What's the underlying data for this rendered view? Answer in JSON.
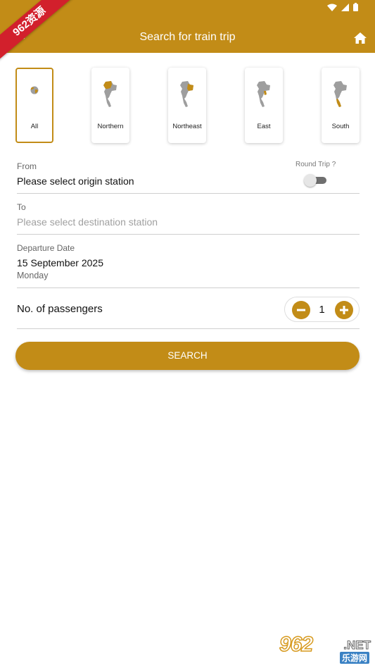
{
  "watermark": {
    "ribbon": "962资源",
    "logo": "962",
    "logo_suffix": ".NET",
    "logo_sub": "乐游网"
  },
  "appbar": {
    "title": "Search for train trip"
  },
  "regions": [
    {
      "label": "All",
      "selected": true
    },
    {
      "label": "Northern",
      "selected": false
    },
    {
      "label": "Northeast",
      "selected": false
    },
    {
      "label": "East",
      "selected": false
    },
    {
      "label": "South",
      "selected": false
    }
  ],
  "form": {
    "from_label": "From",
    "from_value": "Please select origin station",
    "round_trip_label": "Round Trip ?",
    "round_trip_on": false,
    "to_label": "To",
    "to_placeholder": "Please select destination station",
    "departure_label": "Departure Date",
    "departure_date": "15 September 2025",
    "departure_day": "Monday",
    "passengers_label": "No. of passengers",
    "passengers_count": "1"
  },
  "search_button": "SEARCH",
  "colors": {
    "accent": "#C28C17",
    "map_gray": "#9e9e9e"
  }
}
